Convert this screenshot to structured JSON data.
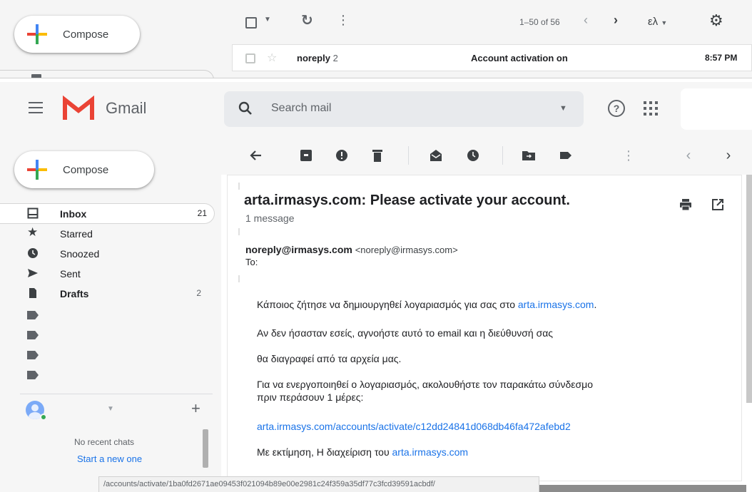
{
  "top_strip": {
    "compose_label": "Compose",
    "range": "1–50 of 56",
    "lang": "ελ",
    "row": {
      "sender": "noreply",
      "count": "2",
      "subject": "Account activation on",
      "time": "8:57 PM"
    }
  },
  "header": {
    "app_name": "Gmail",
    "search_placeholder": "Search mail"
  },
  "sidebar": {
    "compose_label": "Compose",
    "items": [
      {
        "label": "Inbox",
        "count": "21",
        "icon": "inbox-icon",
        "bold": true,
        "active": true
      },
      {
        "label": "Starred",
        "count": "",
        "icon": "star-icon",
        "bold": false,
        "active": false
      },
      {
        "label": "Snoozed",
        "count": "",
        "icon": "clock-icon",
        "bold": false,
        "active": false
      },
      {
        "label": "Sent",
        "count": "",
        "icon": "send-icon",
        "bold": false,
        "active": false
      },
      {
        "label": "Drafts",
        "count": "2",
        "icon": "draft-icon",
        "bold": true,
        "active": false
      }
    ],
    "label_icon_count": 4,
    "chat": {
      "no_recent": "No recent chats",
      "start_new": "Start a new one"
    }
  },
  "toolbar_icons": [
    "back-arrow-icon",
    "archive-icon",
    "report-spam-icon",
    "delete-icon",
    "mark-unread-icon",
    "snooze-icon",
    "move-to-icon",
    "label-icon",
    "more-icon",
    "newer-icon",
    "older-icon"
  ],
  "message": {
    "subject": "arta.irmasys.com: Please activate your account.",
    "count_text": "1 message",
    "from_name": "noreply@irmasys.com",
    "from_email": "<noreply@irmasys.com>",
    "to_label": "To:",
    "body": {
      "p1_text": "Κάποιος ζήτησε να δημιουργηθεί λογαριασμός για σας στο ",
      "p1_link": "arta.irmasys.com",
      "p1_end": ".",
      "p2": "Αν δεν ήσασταν εσείς, αγνοήστε αυτό το email και η διεύθυνσή σας",
      "p3": "θα διαγραφεί από τα αρχεία μας.",
      "p4_line1": "Για να ενεργοποιηθεί ο λογαριασμός, ακολουθήστε τον παρακάτω σύνδεσμο",
      "p4_line2": "πριν περάσουν 1 μέρες:",
      "activation_link": "arta.irmasys.com/accounts/activate/c12dd24841d068db46fa472afebd2",
      "sign_text": "Με εκτίμηση, Η διαχείριση του ",
      "sign_link": "arta.irmasys.com"
    }
  },
  "status_bar_url": "/accounts/activate/1ba0fd2671ae09453f021094b89e00e2981c24f359a35df77c3fcd39591acbdf/",
  "colors": {
    "accent": "#1a73e8",
    "gmail_red": "#ea4335",
    "chat_online": "#34a853"
  }
}
